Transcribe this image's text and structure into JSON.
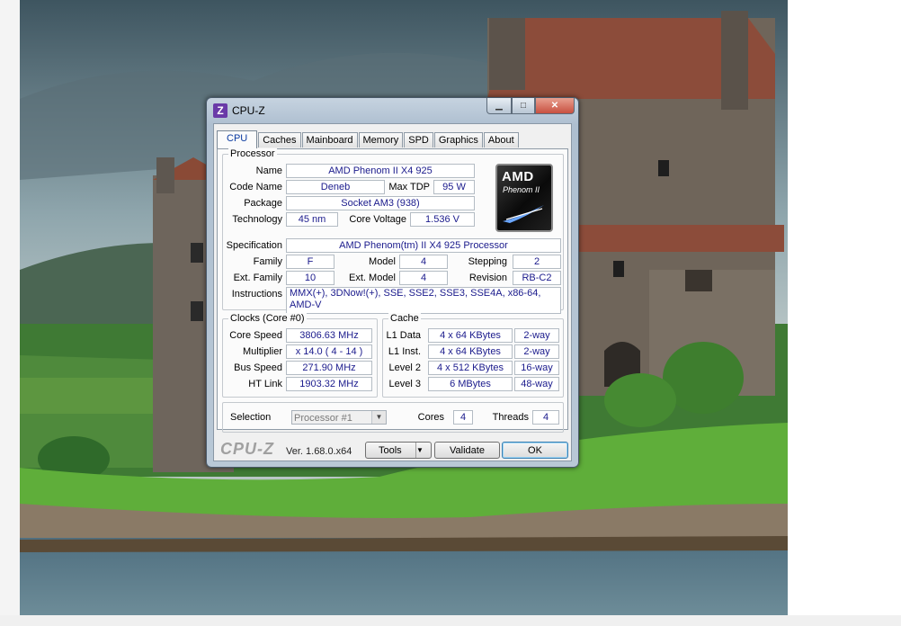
{
  "window": {
    "title": "CPU-Z",
    "app_icon_letter": "Z",
    "min_glyph": "▁",
    "max_glyph": "□",
    "close_glyph": "✕"
  },
  "tabs": [
    "CPU",
    "Caches",
    "Mainboard",
    "Memory",
    "SPD",
    "Graphics",
    "About"
  ],
  "processor": {
    "group_title": "Processor",
    "name_label": "Name",
    "name": "AMD Phenom II X4 925",
    "codename_label": "Code Name",
    "codename": "Deneb",
    "maxtdp_label": "Max TDP",
    "maxtdp": "95 W",
    "package_label": "Package",
    "package": "Socket AM3 (938)",
    "technology_label": "Technology",
    "technology": "45 nm",
    "corevoltage_label": "Core Voltage",
    "corevoltage": "1.536 V",
    "spec_label": "Specification",
    "spec": "AMD Phenom(tm) II X4 925 Processor",
    "family_label": "Family",
    "family": "F",
    "model_label": "Model",
    "model": "4",
    "stepping_label": "Stepping",
    "stepping": "2",
    "extfamily_label": "Ext. Family",
    "extfamily": "10",
    "extmodel_label": "Ext. Model",
    "extmodel": "4",
    "revision_label": "Revision",
    "revision": "RB-C2",
    "instructions_label": "Instructions",
    "instructions": "MMX(+), 3DNow!(+), SSE, SSE2, SSE3, SSE4A, x86-64, AMD-V",
    "logo_brand": "AMD",
    "logo_model": "Phenom II"
  },
  "clocks": {
    "group_title": "Clocks (Core #0)",
    "corespeed_label": "Core Speed",
    "corespeed": "3806.63 MHz",
    "multiplier_label": "Multiplier",
    "multiplier": "x 14.0 ( 4 - 14 )",
    "busspeed_label": "Bus Speed",
    "busspeed": "271.90 MHz",
    "htlink_label": "HT Link",
    "htlink": "1903.32 MHz"
  },
  "cache": {
    "group_title": "Cache",
    "rows": [
      {
        "label": "L1 Data",
        "size": "4 x 64 KBytes",
        "way": "2-way"
      },
      {
        "label": "L1 Inst.",
        "size": "4 x 64 KBytes",
        "way": "2-way"
      },
      {
        "label": "Level 2",
        "size": "4 x 512 KBytes",
        "way": "16-way"
      },
      {
        "label": "Level 3",
        "size": "6 MBytes",
        "way": "48-way"
      }
    ]
  },
  "selection": {
    "label": "Selection",
    "value": "Processor #1",
    "arrow": "▼",
    "cores_label": "Cores",
    "cores": "4",
    "threads_label": "Threads",
    "threads": "4"
  },
  "footer": {
    "brand": "CPU-Z",
    "version": "Ver. 1.68.0.x64",
    "tools_label": "Tools",
    "tools_arrow": "▼",
    "validate_label": "Validate",
    "ok_label": "OK"
  }
}
